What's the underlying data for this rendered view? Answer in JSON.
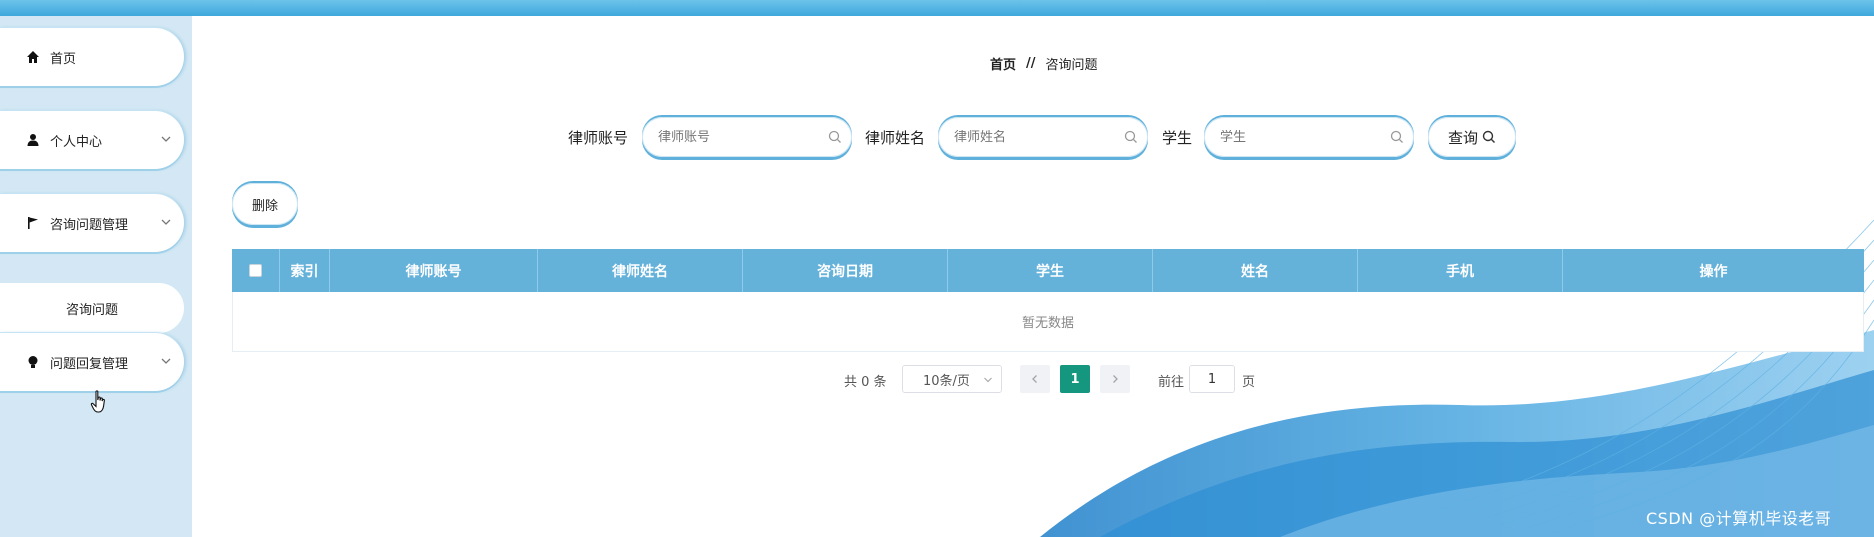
{
  "sidebar": {
    "items": [
      {
        "label": "首页",
        "icon": "home-icon"
      },
      {
        "label": "个人中心",
        "icon": "person-icon",
        "expandable": true
      },
      {
        "label": "咨询问题管理",
        "icon": "flag-icon",
        "expandable": true,
        "expanded": true
      },
      {
        "label": "问题回复管理",
        "icon": "bulb-icon",
        "expandable": true
      }
    ],
    "submenu": {
      "label": "咨询问题"
    }
  },
  "breadcrumb": {
    "home": "首页",
    "separator": "//",
    "current": "咨询问题"
  },
  "search": {
    "fields": [
      {
        "label": "律师账号",
        "placeholder": "律师账号"
      },
      {
        "label": "律师姓名",
        "placeholder": "律师姓名"
      },
      {
        "label": "学生",
        "placeholder": "学生"
      }
    ],
    "button": "查询"
  },
  "actions": {
    "delete": "删除"
  },
  "table": {
    "columns": [
      "索引",
      "律师账号",
      "律师姓名",
      "咨询日期",
      "学生",
      "姓名",
      "手机",
      "操作"
    ],
    "empty": "暂无数据"
  },
  "pagination": {
    "total": "共 0 条",
    "page_size": "10条/页",
    "current_page": "1",
    "goto_prefix": "前往",
    "goto_value": "1",
    "goto_suffix": "页"
  },
  "watermark": "CSDN @计算机毕设老哥",
  "colors": {
    "accent": "#64b1da",
    "topbar": "#3fa8dc",
    "sidebar_bg": "#d3e8f4",
    "active_page": "#15967e"
  }
}
